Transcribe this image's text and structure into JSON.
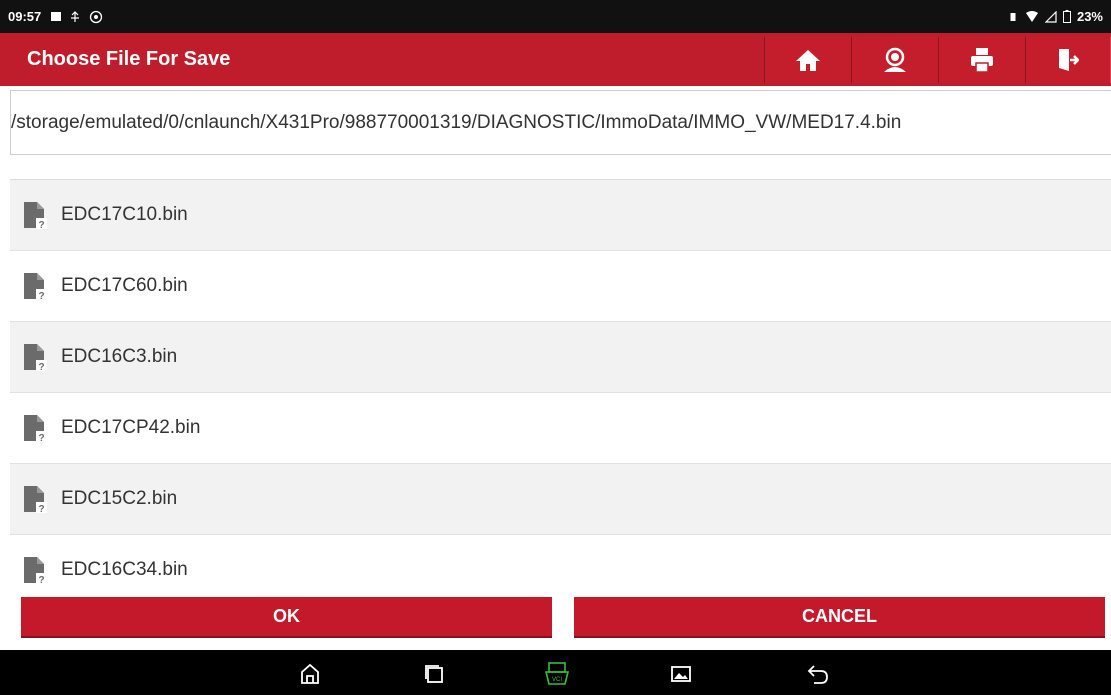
{
  "status": {
    "time": "09:57",
    "battery": "23%"
  },
  "header": {
    "title": "Choose File For Save"
  },
  "toolbar": {
    "home_icon": "home-icon",
    "support_icon": "support-icon",
    "print_icon": "printer-icon",
    "exit_icon": "exit-icon"
  },
  "path": "/storage/emulated/0/cnlaunch/X431Pro/988770001319/DIAGNOSTIC/ImmoData/IMMO_VW/MED17.4.bin",
  "files": [
    "EDC17C10.bin",
    "EDC17C60.bin",
    "EDC16C3.bin",
    "EDC17CP42.bin",
    "EDC15C2.bin",
    "EDC16C34.bin"
  ],
  "buttons": {
    "ok": "OK",
    "cancel": "CANCEL"
  },
  "colors": {
    "brand_red": "#bf1d2c",
    "vci_green": "#3dbb3d"
  }
}
